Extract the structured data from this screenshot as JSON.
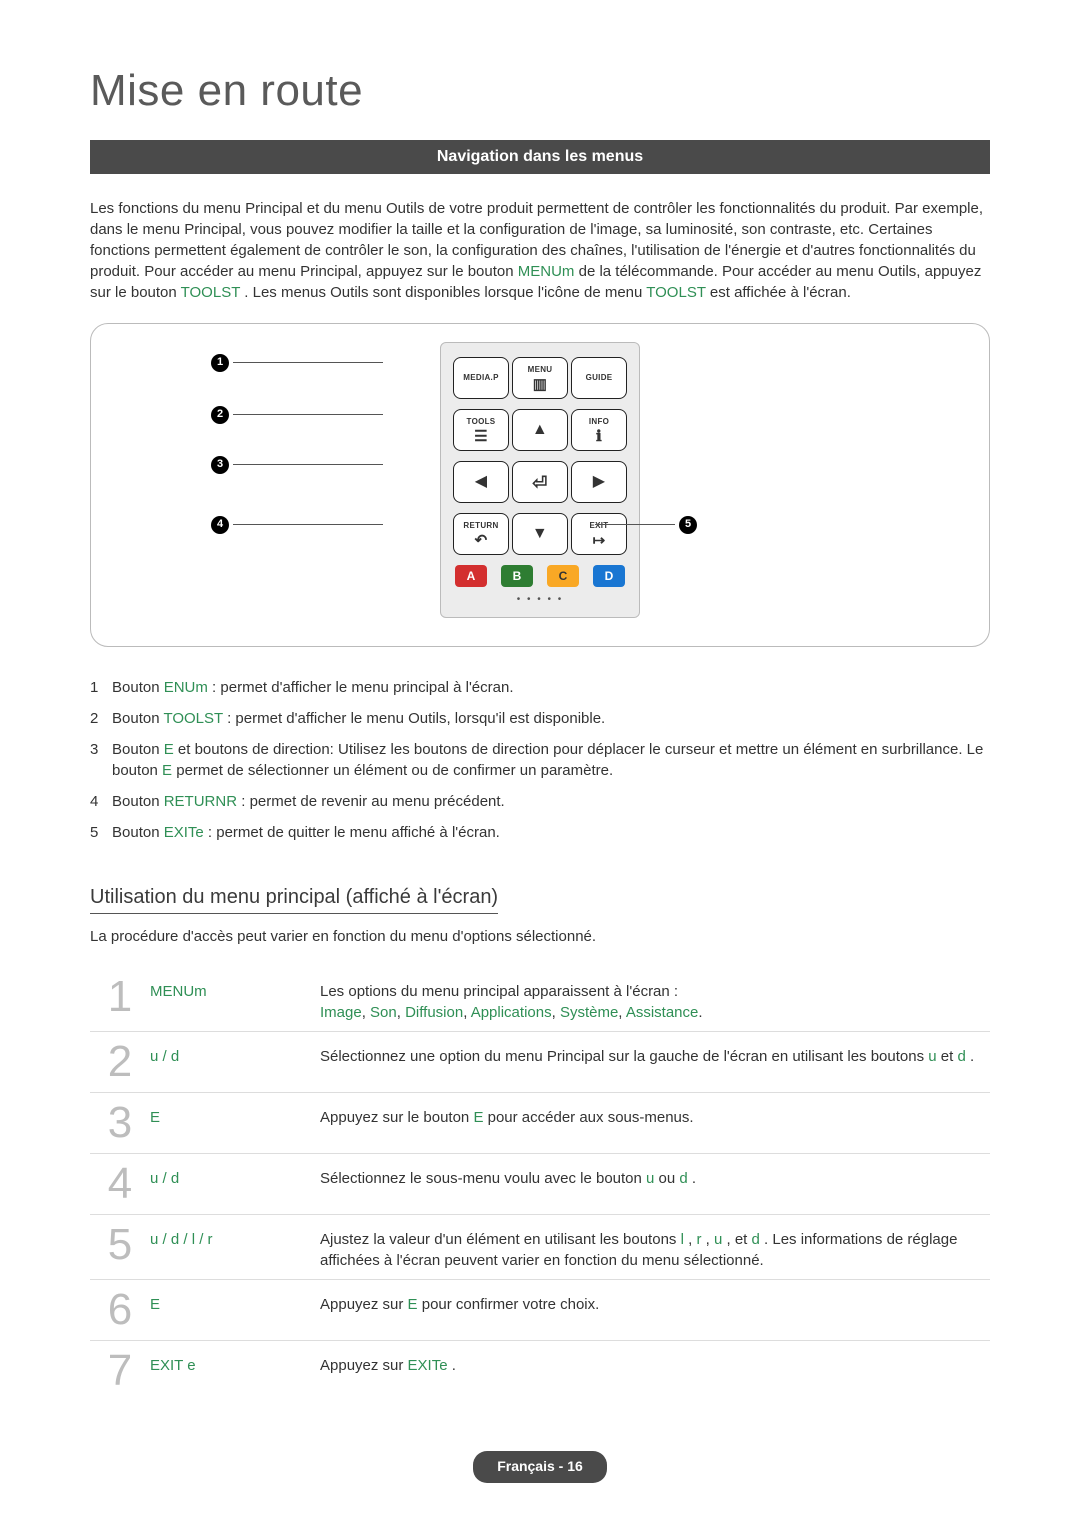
{
  "page_title": "Mise en route",
  "section_bar": "Navigation dans les menus",
  "intro": {
    "pre1": "Les fonctions du menu Principal et du menu Outils de votre produit permettent de contrôler les fonctionnalités du produit. Par exemple, dans le menu Principal, vous pouvez modifier la taille et la configuration de l'image, sa luminosité, son contraste, etc. Certaines fonctions permettent également de contrôler le son, la configuration des chaînes, l'utilisation de l'énergie et d'autres fonctionnalités du produit. Pour accéder au menu Principal, appuyez sur le bouton ",
    "menu_btn": "MENUm",
    "mid1": " de la télécommande. Pour accéder au menu Outils, appuyez sur le bouton ",
    "tools_btn": "TOOLST",
    "mid2": " . Les menus Outils sont disponibles lorsque l'icône de menu ",
    "tools_btn2": "TOOLST",
    "end": " est affichée à l'écran."
  },
  "remote": {
    "media_p": "MEDIA.P",
    "menu": "MENU",
    "guide": "GUIDE",
    "tools": "TOOLS",
    "info": "INFO",
    "return": "RETURN",
    "exit": "EXIT",
    "colors": {
      "a": "A",
      "b": "B",
      "c": "C",
      "d": "D"
    }
  },
  "callouts": {
    "c1": "1",
    "c2": "2",
    "c3": "3",
    "c4": "4",
    "c5": "5"
  },
  "definitions": [
    {
      "num": "1",
      "parts": [
        {
          "t": "Bouton "
        },
        {
          "kw": "ENUm"
        },
        {
          "t": " : permet d'afficher le menu principal à l'écran."
        }
      ]
    },
    {
      "num": "2",
      "parts": [
        {
          "t": "Bouton "
        },
        {
          "kw": "TOOLST"
        },
        {
          "t": " : permet d'afficher le menu Outils, lorsqu'il est disponible."
        }
      ]
    },
    {
      "num": "3",
      "parts": [
        {
          "t": "Bouton "
        },
        {
          "kw": "E"
        },
        {
          "t": " et boutons de direction: Utilisez les boutons de direction pour déplacer le curseur et mettre un élément en surbrillance. Le bouton "
        },
        {
          "kw": "E"
        },
        {
          "t": " permet de sélectionner un élément ou de confirmer un paramètre."
        }
      ]
    },
    {
      "num": "4",
      "parts": [
        {
          "t": "Bouton "
        },
        {
          "kw": "RETURNR"
        },
        {
          "t": " : permet de revenir au menu précédent."
        }
      ]
    },
    {
      "num": "5",
      "parts": [
        {
          "t": "Bouton "
        },
        {
          "kw": "EXITe"
        },
        {
          "t": " : permet de quitter le menu affiché à l'écran."
        }
      ]
    }
  ],
  "subheading": "Utilisation du menu principal (affiché à l'écran)",
  "subnote": "La procédure d'accès peut varier en fonction du menu d'options sélectionné.",
  "steps": [
    {
      "num": "1",
      "action": "MENUm",
      "desc_parts": [
        {
          "t": "Les options du menu principal apparaissent à l'écran :"
        }
      ],
      "desc_line2": [
        {
          "kw": "Image"
        },
        {
          "t": ", "
        },
        {
          "kw": "Son"
        },
        {
          "t": ", "
        },
        {
          "kw": "Diffusion"
        },
        {
          "t": ", "
        },
        {
          "kw": "Applications"
        },
        {
          "t": ", "
        },
        {
          "kw": "Système"
        },
        {
          "t": ", "
        },
        {
          "kw": "Assistance"
        },
        {
          "t": "."
        }
      ]
    },
    {
      "num": "2",
      "action": "u / d",
      "desc_parts": [
        {
          "t": "Sélectionnez une option du menu Principal sur la gauche de l'écran en utilisant les boutons "
        },
        {
          "kw": "u"
        },
        {
          "t": " et "
        },
        {
          "kw": "d"
        },
        {
          "t": " ."
        }
      ]
    },
    {
      "num": "3",
      "action": "E",
      "desc_parts": [
        {
          "t": "Appuyez sur le bouton "
        },
        {
          "kw": "E"
        },
        {
          "t": " pour accéder aux sous-menus."
        }
      ]
    },
    {
      "num": "4",
      "action": "u / d",
      "desc_parts": [
        {
          "t": "Sélectionnez le sous-menu voulu avec le bouton "
        },
        {
          "kw": "u"
        },
        {
          "t": " ou "
        },
        {
          "kw": "d"
        },
        {
          "t": " ."
        }
      ]
    },
    {
      "num": "5",
      "action": "u / d / l / r",
      "desc_parts": [
        {
          "t": "Ajustez la valeur d'un élément en utilisant les boutons "
        },
        {
          "kw": "l"
        },
        {
          "t": " , "
        },
        {
          "kw": "r"
        },
        {
          "t": " , "
        },
        {
          "kw": "u"
        },
        {
          "t": " , et "
        },
        {
          "kw": "d"
        },
        {
          "t": " . Les informations de réglage affichées à l'écran peuvent varier en fonction du menu sélectionné."
        }
      ]
    },
    {
      "num": "6",
      "action": "E",
      "desc_parts": [
        {
          "t": "Appuyez sur "
        },
        {
          "kw": "E"
        },
        {
          "t": " pour confirmer votre choix."
        }
      ]
    },
    {
      "num": "7",
      "action": "EXIT e",
      "desc_parts": [
        {
          "t": "Appuyez sur "
        },
        {
          "kw": "EXITe"
        },
        {
          "t": " ."
        }
      ]
    }
  ],
  "footer": "Français - 16"
}
